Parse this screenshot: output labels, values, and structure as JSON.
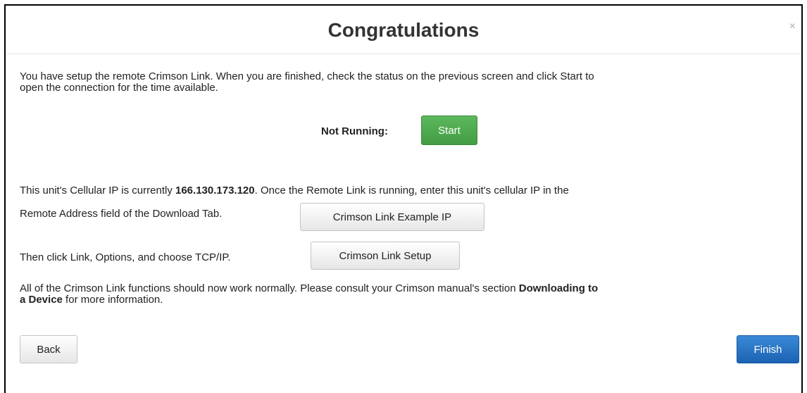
{
  "dialog": {
    "title": "Congratulations",
    "close_glyph": "×"
  },
  "intro": {
    "line1": "You have setup the remote Crimson Link. When you are finished, check the status on the previous screen and click Start to",
    "line2": "open the connection for the time available."
  },
  "status": {
    "label": "Not Running:",
    "start_button": "Start"
  },
  "cellular": {
    "prefix": "This unit's Cellular IP is currently ",
    "ip": "166.130.173.120",
    "suffix": ". Once the Remote Link is running, enter this unit's cellular IP in the",
    "line2": "Remote Address field of the Download Tab.",
    "example_button": "Crimson Link Example IP"
  },
  "link": {
    "text": "Then click Link, Options, and choose TCP/IP.",
    "setup_button": "Crimson Link Setup"
  },
  "consult": {
    "line1_prefix": "All of the Crimson Link functions should now work normally. Please consult your Crimson manual's section ",
    "line1_bold": "Downloading to",
    "line2_bold": "a Device",
    "line2_suffix": " for more information."
  },
  "footer": {
    "back_button": "Back",
    "finish_button": "Finish"
  }
}
